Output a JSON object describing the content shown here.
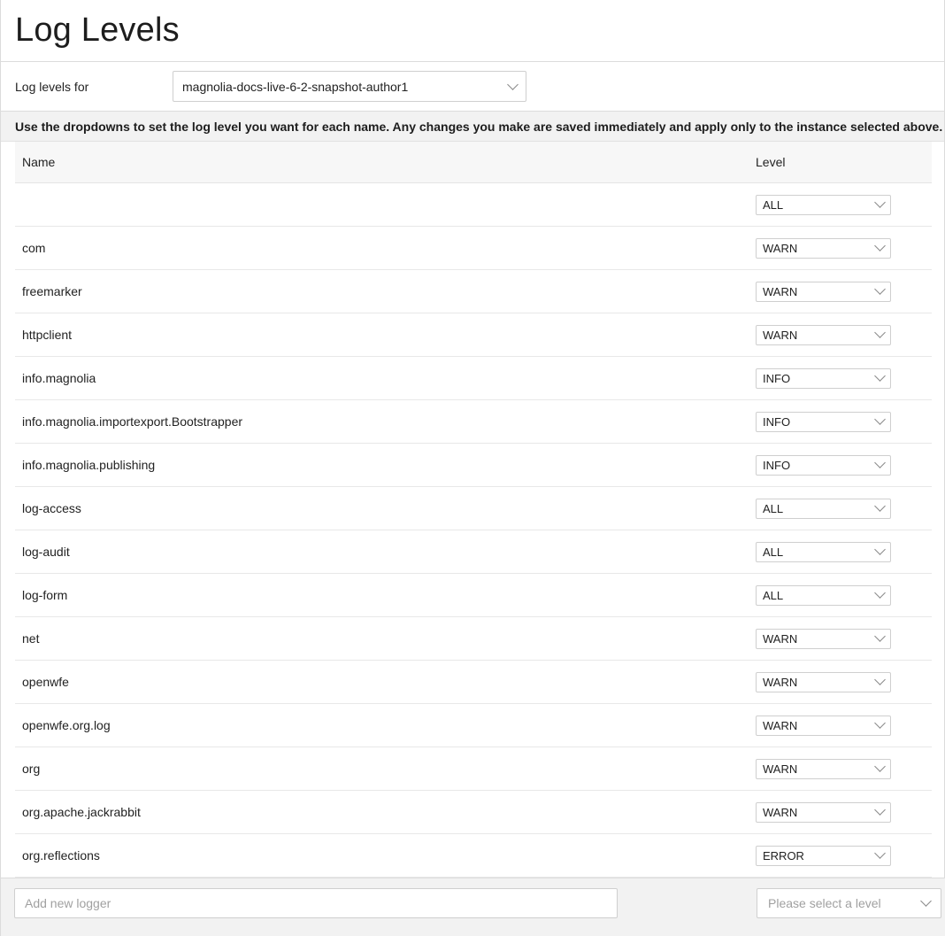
{
  "page": {
    "title": "Log Levels"
  },
  "instance": {
    "label": "Log levels for",
    "selected": "magnolia-docs-live-6-2-snapshot-author1"
  },
  "info": "Use the dropdowns to set the log level you want for each name. Any changes you make are saved immediately and apply only to the instance selected above.",
  "table": {
    "columns": {
      "name": "Name",
      "level": "Level"
    },
    "rows": [
      {
        "name": "",
        "level": "ALL"
      },
      {
        "name": "com",
        "level": "WARN"
      },
      {
        "name": "freemarker",
        "level": "WARN"
      },
      {
        "name": "httpclient",
        "level": "WARN"
      },
      {
        "name": "info.magnolia",
        "level": "INFO"
      },
      {
        "name": "info.magnolia.importexport.Bootstrapper",
        "level": "INFO"
      },
      {
        "name": "info.magnolia.publishing",
        "level": "INFO"
      },
      {
        "name": "log-access",
        "level": "ALL"
      },
      {
        "name": "log-audit",
        "level": "ALL"
      },
      {
        "name": "log-form",
        "level": "ALL"
      },
      {
        "name": "net",
        "level": "WARN"
      },
      {
        "name": "openwfe",
        "level": "WARN"
      },
      {
        "name": "openwfe.org.log",
        "level": "WARN"
      },
      {
        "name": "org",
        "level": "WARN"
      },
      {
        "name": "org.apache.jackrabbit",
        "level": "WARN"
      },
      {
        "name": "org.reflections",
        "level": "ERROR"
      }
    ]
  },
  "footer": {
    "new_logger_placeholder": "Add new logger",
    "level_placeholder": "Please select a level"
  },
  "icons": {
    "dropdown": "chevron-down-icon"
  }
}
